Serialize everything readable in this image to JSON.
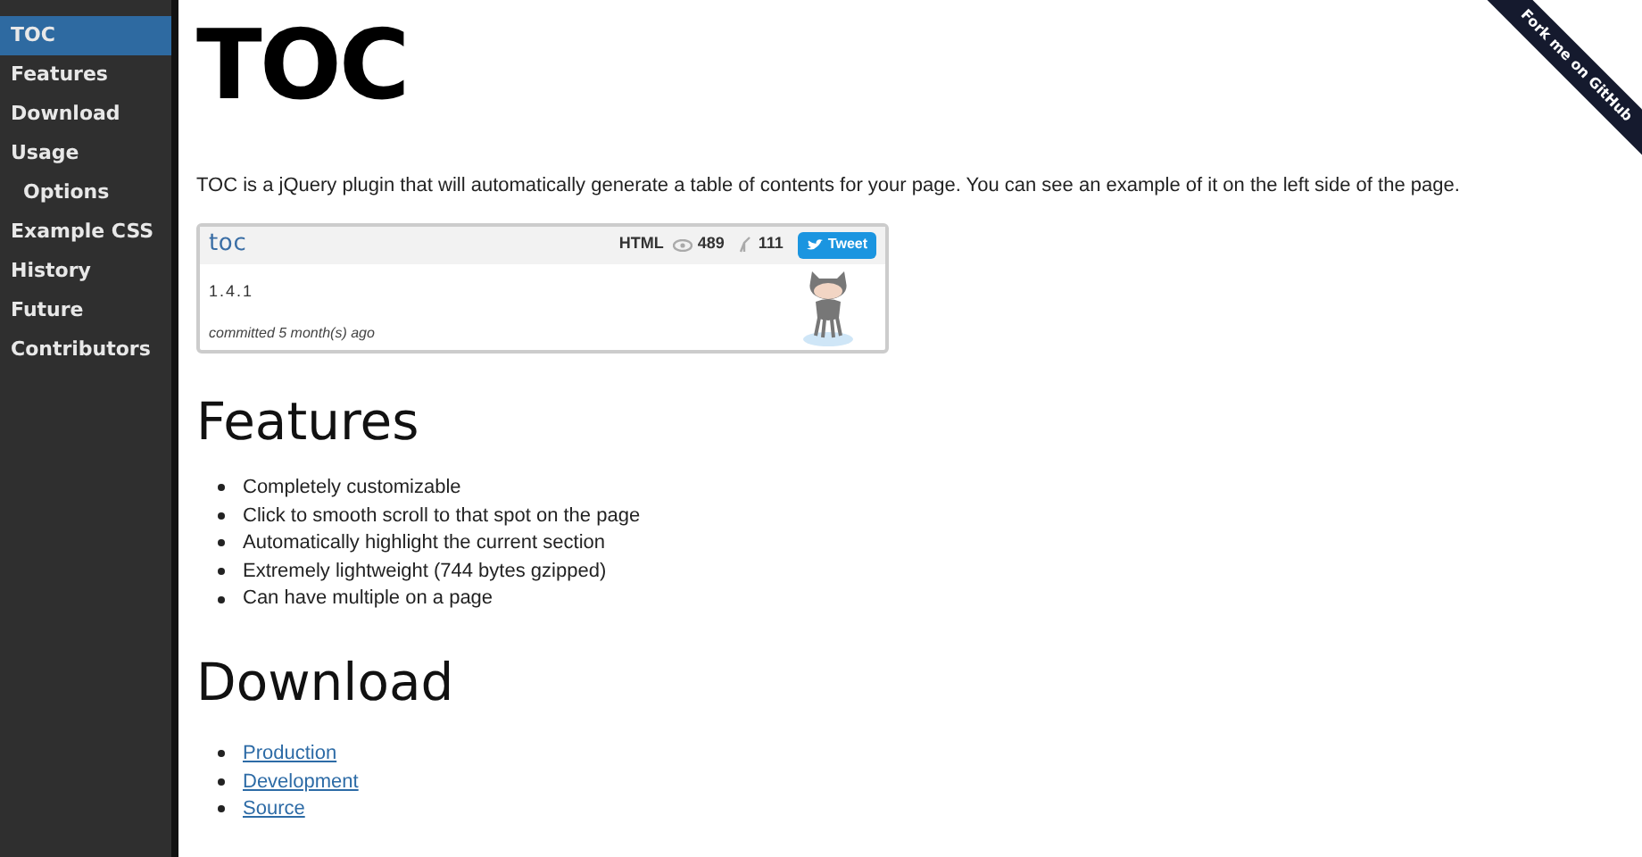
{
  "sidebar": {
    "items": [
      {
        "label": "TOC",
        "selected": true
      },
      {
        "label": "Features",
        "selected": false
      },
      {
        "label": "Download",
        "selected": false
      },
      {
        "label": "Usage",
        "selected": false,
        "children": [
          {
            "label": "Options",
            "selected": false
          }
        ]
      },
      {
        "label": "Example CSS",
        "selected": false
      },
      {
        "label": "History",
        "selected": false
      },
      {
        "label": "Future",
        "selected": false
      },
      {
        "label": "Contributors",
        "selected": false
      }
    ]
  },
  "ribbon": "Fork me on GitHub",
  "title": "TOC",
  "intro": "TOC is a jQuery plugin that will automatically generate a table of contents for your page. You can see an example of it on the left side of the page.",
  "repo_card": {
    "name": "toc",
    "language": "HTML",
    "watchers": "489",
    "forks": "111",
    "tweet": "Tweet",
    "version": "1.4.1",
    "committed": "committed 5 month(s) ago"
  },
  "features": {
    "heading": "Features",
    "items": [
      "Completely customizable",
      "Click to smooth scroll to that spot on the page",
      "Automatically highlight the current section",
      "Extremely lightweight (744 bytes gzipped)",
      "Can have multiple on a page"
    ]
  },
  "download": {
    "heading": "Download",
    "links": [
      "Production",
      "Development",
      "Source"
    ]
  }
}
